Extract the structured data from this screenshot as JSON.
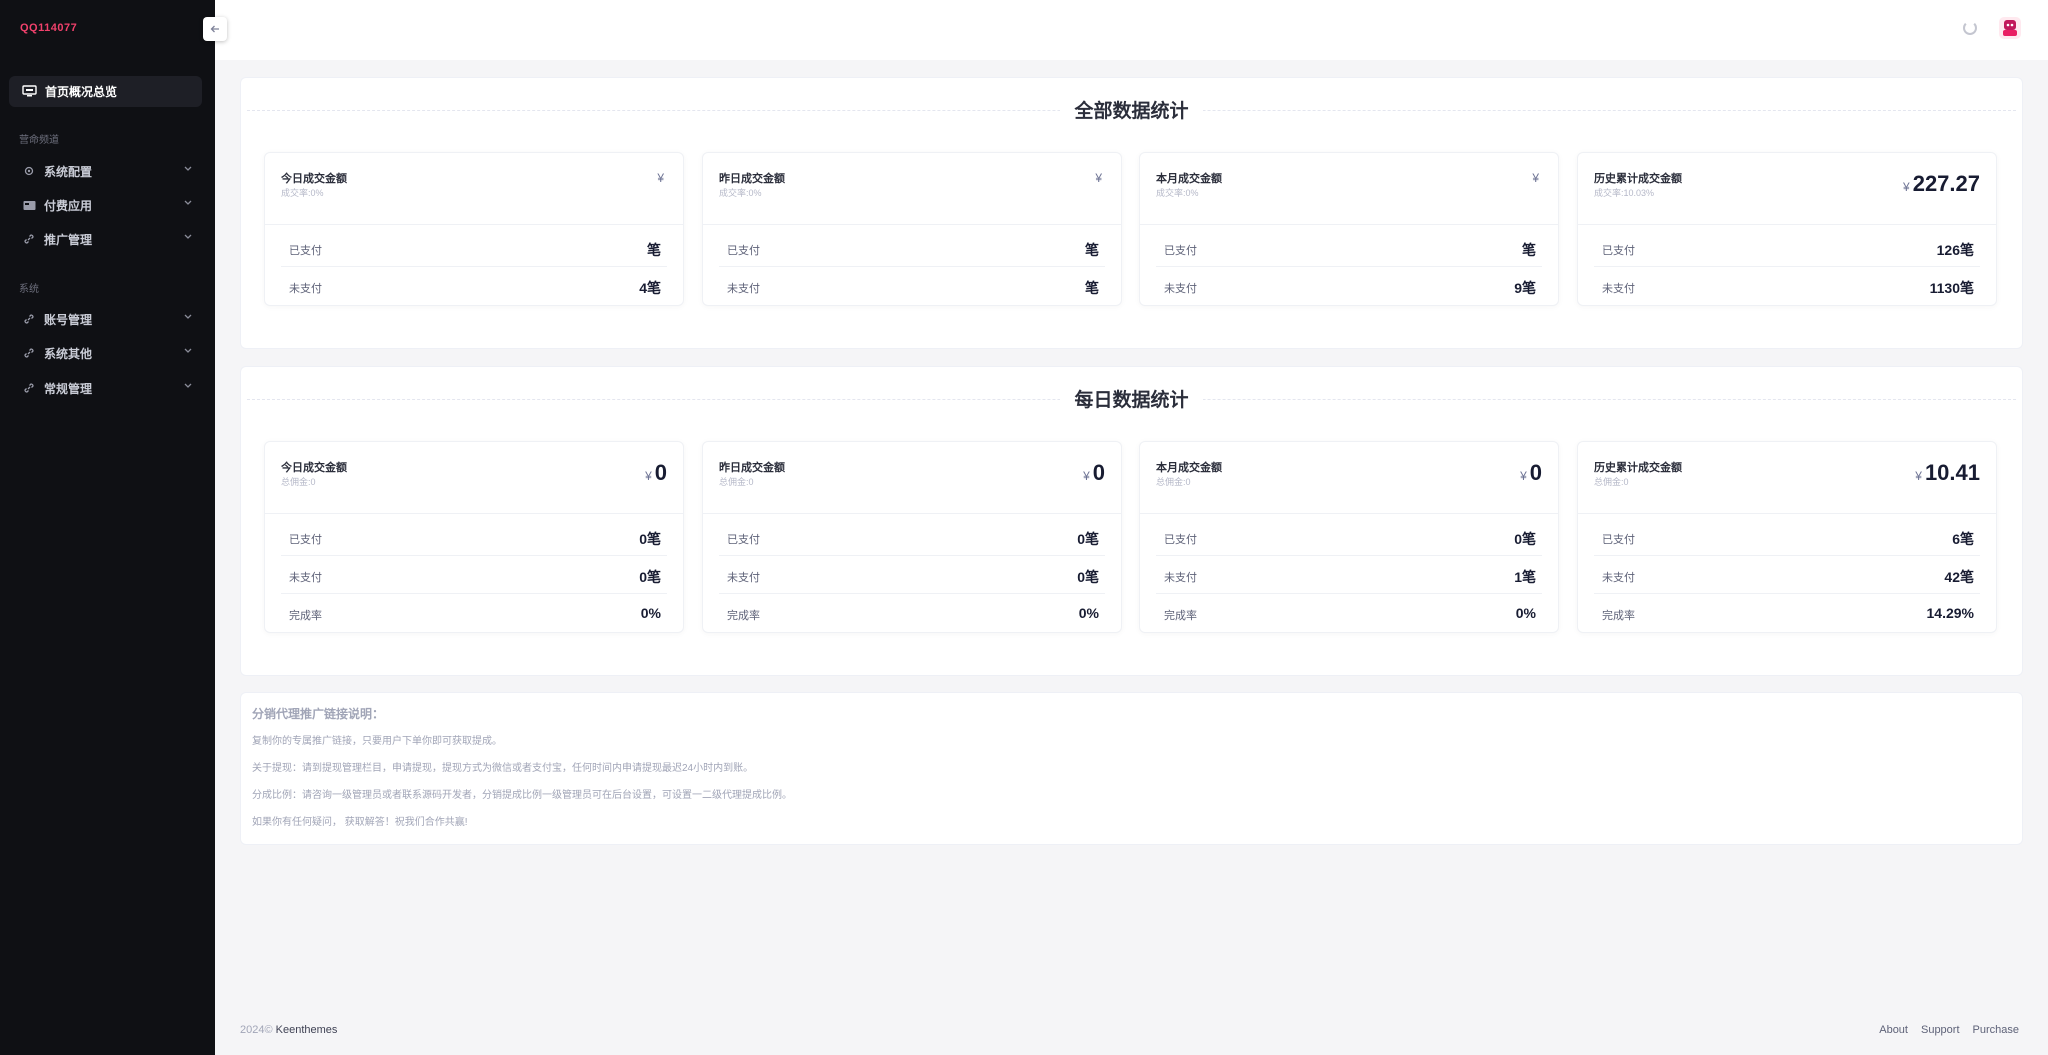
{
  "brand": "QQ114077",
  "sidebar": {
    "active": "首页概况总览",
    "section1": "营命频道",
    "group1": [
      {
        "label": "系统配置",
        "icon": "gear-icon"
      },
      {
        "label": "付费应用",
        "icon": "card-icon"
      },
      {
        "label": "推广管理",
        "icon": "link-icon"
      }
    ],
    "section2": "系统",
    "group2": [
      {
        "label": "账号管理",
        "icon": "link-icon"
      },
      {
        "label": "系统其他",
        "icon": "link-icon"
      },
      {
        "label": "常规管理",
        "icon": "link-icon"
      }
    ]
  },
  "panel1": {
    "title": "全部数据统计",
    "cards": [
      {
        "title": "今日成交金额",
        "sub": "成交率:0%",
        "currency": "¥",
        "amount": "",
        "rows": [
          {
            "label": "已支付",
            "value": "笔"
          },
          {
            "label": "未支付",
            "value": "4笔"
          }
        ]
      },
      {
        "title": "昨日成交金额",
        "sub": "成交率:0%",
        "currency": "¥",
        "amount": "",
        "rows": [
          {
            "label": "已支付",
            "value": "笔"
          },
          {
            "label": "未支付",
            "value": "笔"
          }
        ]
      },
      {
        "title": "本月成交金额",
        "sub": "成交率:0%",
        "currency": "¥",
        "amount": "",
        "rows": [
          {
            "label": "已支付",
            "value": "笔"
          },
          {
            "label": "未支付",
            "value": "9笔"
          }
        ]
      },
      {
        "title": "历史累计成交金额",
        "sub": "成交率:10.03%",
        "currency": "¥",
        "amount": "227.27",
        "rows": [
          {
            "label": "已支付",
            "value": "126笔"
          },
          {
            "label": "未支付",
            "value": "1130笔"
          }
        ]
      }
    ]
  },
  "panel2": {
    "title": "每日数据统计",
    "cards": [
      {
        "title": "今日成交金额",
        "sub": "总佣金:0",
        "currency": "¥",
        "amount": "0",
        "rows": [
          {
            "label": "已支付",
            "value": "0笔"
          },
          {
            "label": "未支付",
            "value": "0笔"
          },
          {
            "label": "完成率",
            "value": "0%"
          }
        ]
      },
      {
        "title": "昨日成交金额",
        "sub": "总佣金:0",
        "currency": "¥",
        "amount": "0",
        "rows": [
          {
            "label": "已支付",
            "value": "0笔"
          },
          {
            "label": "未支付",
            "value": "0笔"
          },
          {
            "label": "完成率",
            "value": "0%"
          }
        ]
      },
      {
        "title": "本月成交金额",
        "sub": "总佣金:0",
        "currency": "¥",
        "amount": "0",
        "rows": [
          {
            "label": "已支付",
            "value": "0笔"
          },
          {
            "label": "未支付",
            "value": "1笔"
          },
          {
            "label": "完成率",
            "value": "0%"
          }
        ]
      },
      {
        "title": "历史累计成交金额",
        "sub": "总佣金:0",
        "currency": "¥",
        "amount": "10.41",
        "rows": [
          {
            "label": "已支付",
            "value": "6笔"
          },
          {
            "label": "未支付",
            "value": "42笔"
          },
          {
            "label": "完成率",
            "value": "14.29%"
          }
        ]
      }
    ]
  },
  "info": {
    "title": "分销代理推广链接说明：",
    "lines": [
      "复制你的专属推广链接，只要用户下单你即可获取提成。",
      "关于提现：请到提现管理栏目，申请提现，提现方式为微信或者支付宝，任何时间内申请提现最迟24小时内到账。",
      "分成比例：请咨询一级管理员或者联系源码开发者，分销提成比例一级管理员可在后台设置，可设置一二级代理提成比例。",
      "如果你有任何疑问， 获取解答！祝我们合作共赢!"
    ]
  },
  "footer": {
    "year": "2024©",
    "company": "Keenthemes",
    "links": [
      "About",
      "Support",
      "Purchase"
    ]
  }
}
